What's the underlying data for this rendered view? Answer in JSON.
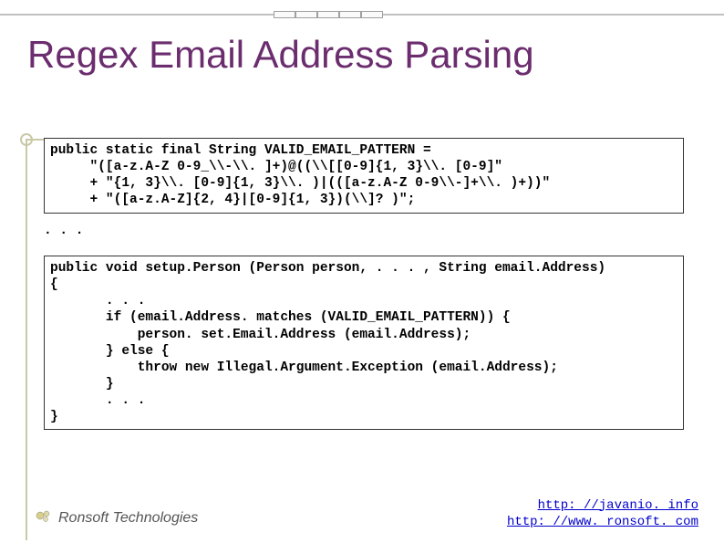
{
  "title": "Regex Email Address Parsing",
  "code1": "public static final String VALID_EMAIL_PATTERN =\n     \"([a-z.A-Z 0-9_\\\\-\\\\. ]+)@((\\\\[[0-9]{1, 3}\\\\. [0-9]\"\n     + \"{1, 3}\\\\. [0-9]{1, 3}\\\\. )|(([a-z.A-Z 0-9\\\\-]+\\\\. )+))\"\n     + \"([a-z.A-Z]{2, 4}|[0-9]{1, 3})(\\\\]? )\";",
  "ellipsis": ". . .",
  "code2": "public void setup.Person (Person person, . . . , String email.Address)\n{\n       . . .\n       if (email.Address. matches (VALID_EMAIL_PATTERN)) {\n           person. set.Email.Address (email.Address);\n       } else {\n           throw new Illegal.Argument.Exception (email.Address);\n       }\n       . . .\n}",
  "footer": {
    "company": "Ronsoft Technologies",
    "link1": "http: //javanio. info",
    "link2": "http: //www. ronsoft. com"
  }
}
